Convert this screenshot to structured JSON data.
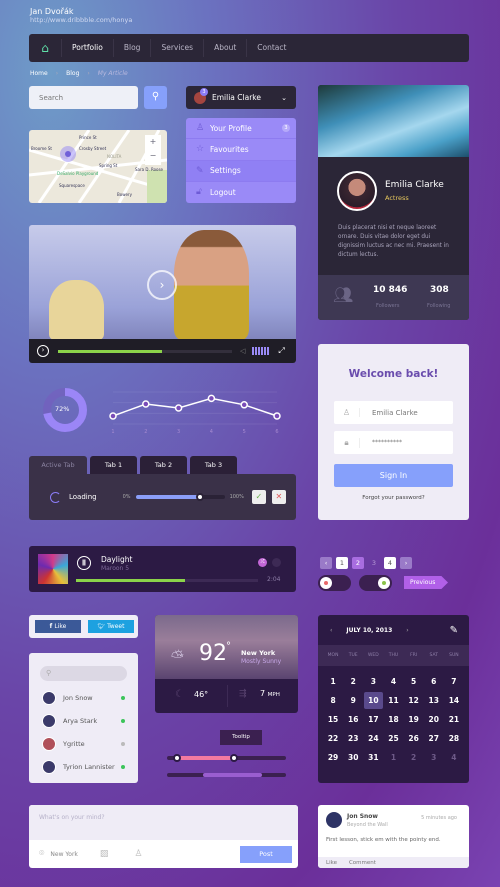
{
  "header": {
    "author": "Jan Dvořák",
    "url": "http://www.dribbble.com/honya"
  },
  "nav": {
    "items": [
      "Portfolio",
      "Blog",
      "Services",
      "About",
      "Contact"
    ],
    "active": "Portfolio"
  },
  "breadcrumb": [
    "Home",
    "Blog",
    "My Article"
  ],
  "search": {
    "placeholder": "Search"
  },
  "map": {
    "labels": [
      "Prince St",
      "Crosby Street",
      "NOLITA",
      "Spring St",
      "DeSalvio Playground",
      "Sara D. Roose",
      "Squarespace",
      "Bowery",
      "Broome St"
    ],
    "zoom_in": "+",
    "zoom_out": "−"
  },
  "user_dropdown": {
    "name": "Emilia Clarke",
    "badge": "3",
    "menu": [
      {
        "label": "Your Profile",
        "icon": "user-icon",
        "badge": "3"
      },
      {
        "label": "Favourites",
        "icon": "star-icon"
      },
      {
        "label": "Settings",
        "icon": "wrench-icon"
      },
      {
        "label": "Logout",
        "icon": "lock-icon"
      }
    ]
  },
  "profile": {
    "name": "Emilia Clarke",
    "role": "Actress",
    "bio": "Duis placerat nisi et neque laoreet ornare. Duis vitae dolor eget dui dignissim luctus ac nec mi. Praesent in dictum lectus.",
    "followers": "10 846",
    "followers_label": "Followers",
    "following": "308",
    "following_label": "Following"
  },
  "video": {
    "progress": 0.6,
    "volume_bars": 6
  },
  "donut": {
    "value": 72,
    "label": "72%"
  },
  "chart_data": {
    "type": "line",
    "categories": [
      "1",
      "2",
      "3",
      "4",
      "5",
      "6"
    ],
    "values": [
      1,
      2.5,
      2,
      3.2,
      2.4,
      1
    ],
    "ylim": [
      0,
      4
    ],
    "grid": true
  },
  "tabs": {
    "items": [
      "Active Tab",
      "Tab 1",
      "Tab 2",
      "Tab 3"
    ],
    "active": 0
  },
  "loading": {
    "label": "Loading",
    "min": "0%",
    "max": "100%",
    "value": 0.72
  },
  "login": {
    "title": "Welcome back!",
    "username": "Emilia Clarke",
    "password": "**********",
    "submit": "Sign In",
    "forgot": "Forgot your password?"
  },
  "music": {
    "title": "Daylight",
    "artist": "Maroon 5",
    "time": "2:04",
    "progress": 0.6
  },
  "pagination": {
    "pages": [
      "1",
      "2",
      "3",
      "4"
    ],
    "current": "2"
  },
  "toggles": [
    {
      "on": false,
      "color": "#e86a6a"
    },
    {
      "on": true,
      "color": "#8bc34a"
    }
  ],
  "previous_button": "Previous",
  "social": {
    "like": "Like",
    "tweet": "Tweet"
  },
  "contacts": [
    {
      "name": "Jon Snow",
      "online": true
    },
    {
      "name": "Arya Stark",
      "online": true
    },
    {
      "name": "Ygritte",
      "online": false
    },
    {
      "name": "Tyrion Lannister",
      "online": true
    }
  ],
  "weather": {
    "temp": "92",
    "deg": "°",
    "city": "New York",
    "condition": "Mostly Sunny",
    "night": "46°",
    "wind": "7",
    "wind_unit": "MPH"
  },
  "tooltip": "Tooltip",
  "range": {
    "low": 0.08,
    "high": 0.56
  },
  "range2": {
    "low": 0.3,
    "high": 0.8
  },
  "calendar": {
    "title": "JULY 10, 2013",
    "weekdays": [
      "MON",
      "TUE",
      "WED",
      "THU",
      "FRI",
      "SAT",
      "SUN"
    ],
    "weeks": [
      [
        "1",
        "2",
        "3",
        "4",
        "5",
        "6",
        "7"
      ],
      [
        "8",
        "9",
        "10",
        "11",
        "12",
        "13",
        "14"
      ],
      [
        "15",
        "16",
        "17",
        "18",
        "19",
        "20",
        "21"
      ],
      [
        "22",
        "23",
        "24",
        "25",
        "26",
        "27",
        "28"
      ],
      [
        "29",
        "30",
        "31",
        "1",
        "2",
        "3",
        "4"
      ]
    ],
    "selected": "10"
  },
  "post": {
    "placeholder": "What's on your mind?",
    "location": "New York",
    "submit": "Post"
  },
  "comment": {
    "author": "Jon Snow",
    "subtitle": "Beyond the Wall",
    "time": "5 minutes ago",
    "text": "First lesson, stick em with the pointy end.",
    "like": "Like",
    "reply": "Comment"
  },
  "colors": {
    "accent": "#8b7cf6",
    "button": "#86a0fb",
    "dark": "#2b2637",
    "green": "#8bd34a",
    "pink": "#f47aa0",
    "yellow": "#e6c75d"
  }
}
